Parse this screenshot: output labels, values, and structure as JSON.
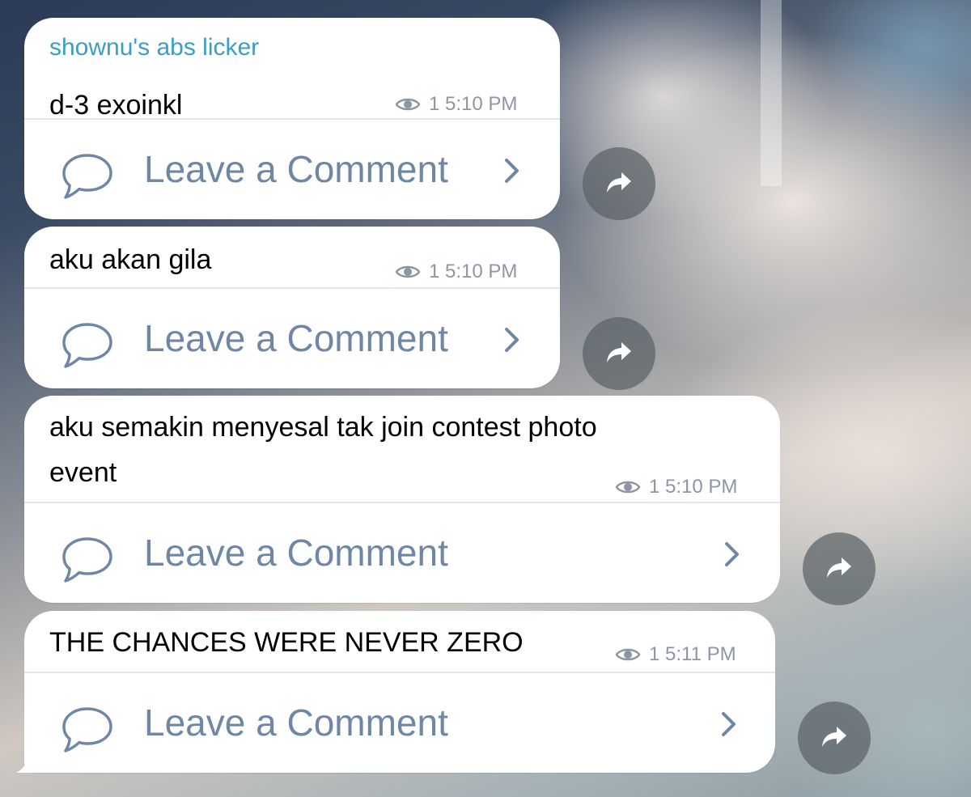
{
  "messages": [
    {
      "sender": "shownu's abs licker",
      "text": "d-3 exoinkl",
      "views": "1",
      "time": "5:10 PM",
      "comment_label": "Leave a Comment"
    },
    {
      "text": "aku akan gila",
      "views": "1",
      "time": "5:10 PM",
      "comment_label": "Leave a Comment"
    },
    {
      "text": "aku semakin menyesal tak join contest photo\nevent",
      "views": "1",
      "time": "5:10 PM",
      "comment_label": "Leave a Comment"
    },
    {
      "text": "THE CHANCES WERE NEVER ZERO",
      "views": "1",
      "time": "5:11 PM",
      "comment_label": "Leave a Comment"
    }
  ],
  "icons": {
    "views": "eye-icon",
    "comment": "speech-bubble-icon",
    "chevron": "chevron-right-icon",
    "share": "share-arrow-icon"
  },
  "colors": {
    "sender_name": "#3a9fc4",
    "comment_link": "#6f87a4",
    "meta": "#8d97a3",
    "bubble": "#ffffff"
  }
}
